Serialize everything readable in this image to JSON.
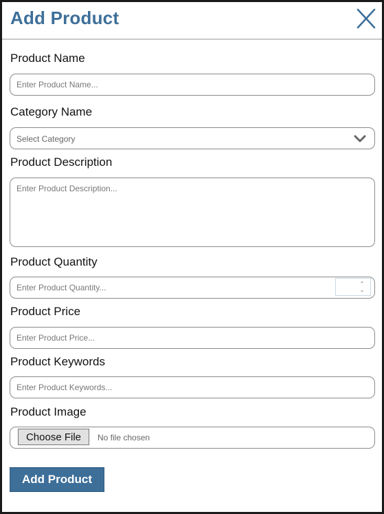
{
  "modal": {
    "title": "Add Product",
    "close_icon": "close-x-icon"
  },
  "form": {
    "product_name": {
      "label": "Product Name",
      "placeholder": "Enter Product Name...",
      "value": ""
    },
    "category": {
      "label": "Category Name",
      "selected": "Select Category",
      "icon": "chevron-down-icon"
    },
    "description": {
      "label": "Product Description",
      "placeholder": "Enter Product Description...",
      "value": ""
    },
    "quantity": {
      "label": "Product Quantity",
      "placeholder": "Enter Product Quantity...",
      "value": ""
    },
    "price": {
      "label": "Product Price",
      "placeholder": "Enter Product Price...",
      "value": ""
    },
    "keywords": {
      "label": "Product Keywords",
      "placeholder": "Enter Product Keywords...",
      "value": ""
    },
    "image": {
      "label": "Product Image",
      "button_label": "Choose File",
      "status": "No file chosen"
    },
    "submit_label": "Add Product"
  },
  "colors": {
    "accent": "#3d6f99",
    "border": "#8a8a8a",
    "placeholder": "#777777"
  }
}
